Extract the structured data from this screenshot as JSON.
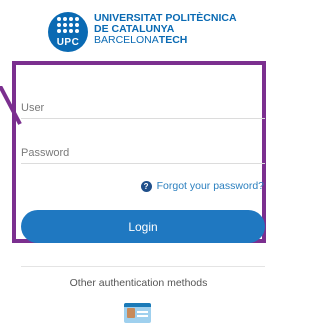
{
  "brand": {
    "mark": "UPC",
    "line1": "UNIVERSITAT POLITÈCNICA",
    "line2": "DE CATALUNYA",
    "line3_light": "BARCELONA",
    "line3_bold": "TECH"
  },
  "form": {
    "user_placeholder": "User",
    "password_placeholder": "Password",
    "forgot": "Forgot your password?",
    "login": "Login"
  },
  "alt": {
    "label": "Other authentication methods",
    "icon": "id-card-icon"
  },
  "colors": {
    "brand_blue": "#0a6ab3",
    "button_blue": "#1f78c1",
    "highlight_frame": "#7b2f8f"
  }
}
